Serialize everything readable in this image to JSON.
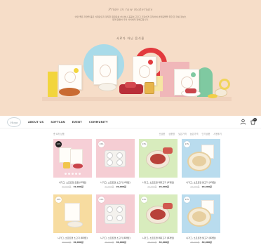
{
  "hero": {
    "eyebrow": "Pride in raw materials",
    "description": "어떤 좋은 자연을 품은 식재료인지 정직한 원재료를 하나하나 꼼꼼히 고르고 건강하게 조리하여 반려동물을 위한 한 끼를 정성스럽게 만들어 우리 아이에게 전해드립니다.",
    "subtitle": "사료가 아닌 음식을"
  },
  "nav": {
    "logo_text": "Hoya",
    "menu": [
      "ABOUT US",
      "SOFTCAN",
      "EVENT",
      "COMMUNITY"
    ],
    "cart_count": "0"
  },
  "list": {
    "total": "총 8개 상품",
    "sorts": [
      "신상품",
      "상품명",
      "낮은가격",
      "높은가격",
      "인기상품",
      "사용후기"
    ]
  },
  "products": [
    {
      "name": "니가그, 소프트캔 모음 (6개입)",
      "old_price": "39,000원",
      "price": "32,000원",
      "badge": "13%",
      "bg": "#f6cfd6",
      "dark_badge": true
    },
    {
      "name": "니가그, 소프트캔 소고기 (4개입)",
      "old_price": "24,000원",
      "price": "20,000원",
      "badge": "13%",
      "bg": "#f5cdd3",
      "dark_badge": false
    },
    {
      "name": "니가그, 소프트캔 돼지고기 (4개입)",
      "old_price": "24,000원",
      "price": "20,000원",
      "badge": "13%",
      "bg": "#d8ecbd",
      "dark_badge": false
    },
    {
      "name": "니가그, 소프트캔 닭고기 (4개입)",
      "old_price": "24,000원",
      "price": "20,000원",
      "badge": "13%",
      "bg": "#b9dcee",
      "dark_badge": false
    },
    {
      "name": "니가그, 소프트캔 소고기 (8개입)",
      "old_price": "48,000원",
      "price": "40,000원",
      "badge": "13%",
      "bg": "#f7dca0",
      "dark_badge": false
    },
    {
      "name": "니가그, 소프트캔 소고기 (8개입)",
      "old_price": "48,000원",
      "price": "40,000원",
      "badge": "13%",
      "bg": "#f5cdd3",
      "dark_badge": false
    },
    {
      "name": "니가그, 소프트캔 돼지고기 (8개입)",
      "old_price": "48,000원",
      "price": "40,000원",
      "badge": "13%",
      "bg": "#d8ecbd",
      "dark_badge": false
    },
    {
      "name": "니가그, 소프트캔 닭고기 (8개입)",
      "old_price": "48,000원",
      "price": "40,000원",
      "badge": "13%",
      "bg": "#b9dcee",
      "dark_badge": false
    }
  ],
  "icons": {
    "user": "user-icon",
    "cart": "cart-icon"
  },
  "colors": {
    "hero_bg": "#f6ddc8",
    "accent_red": "#e23a3e",
    "accent_blue": "#a9dbe9"
  }
}
